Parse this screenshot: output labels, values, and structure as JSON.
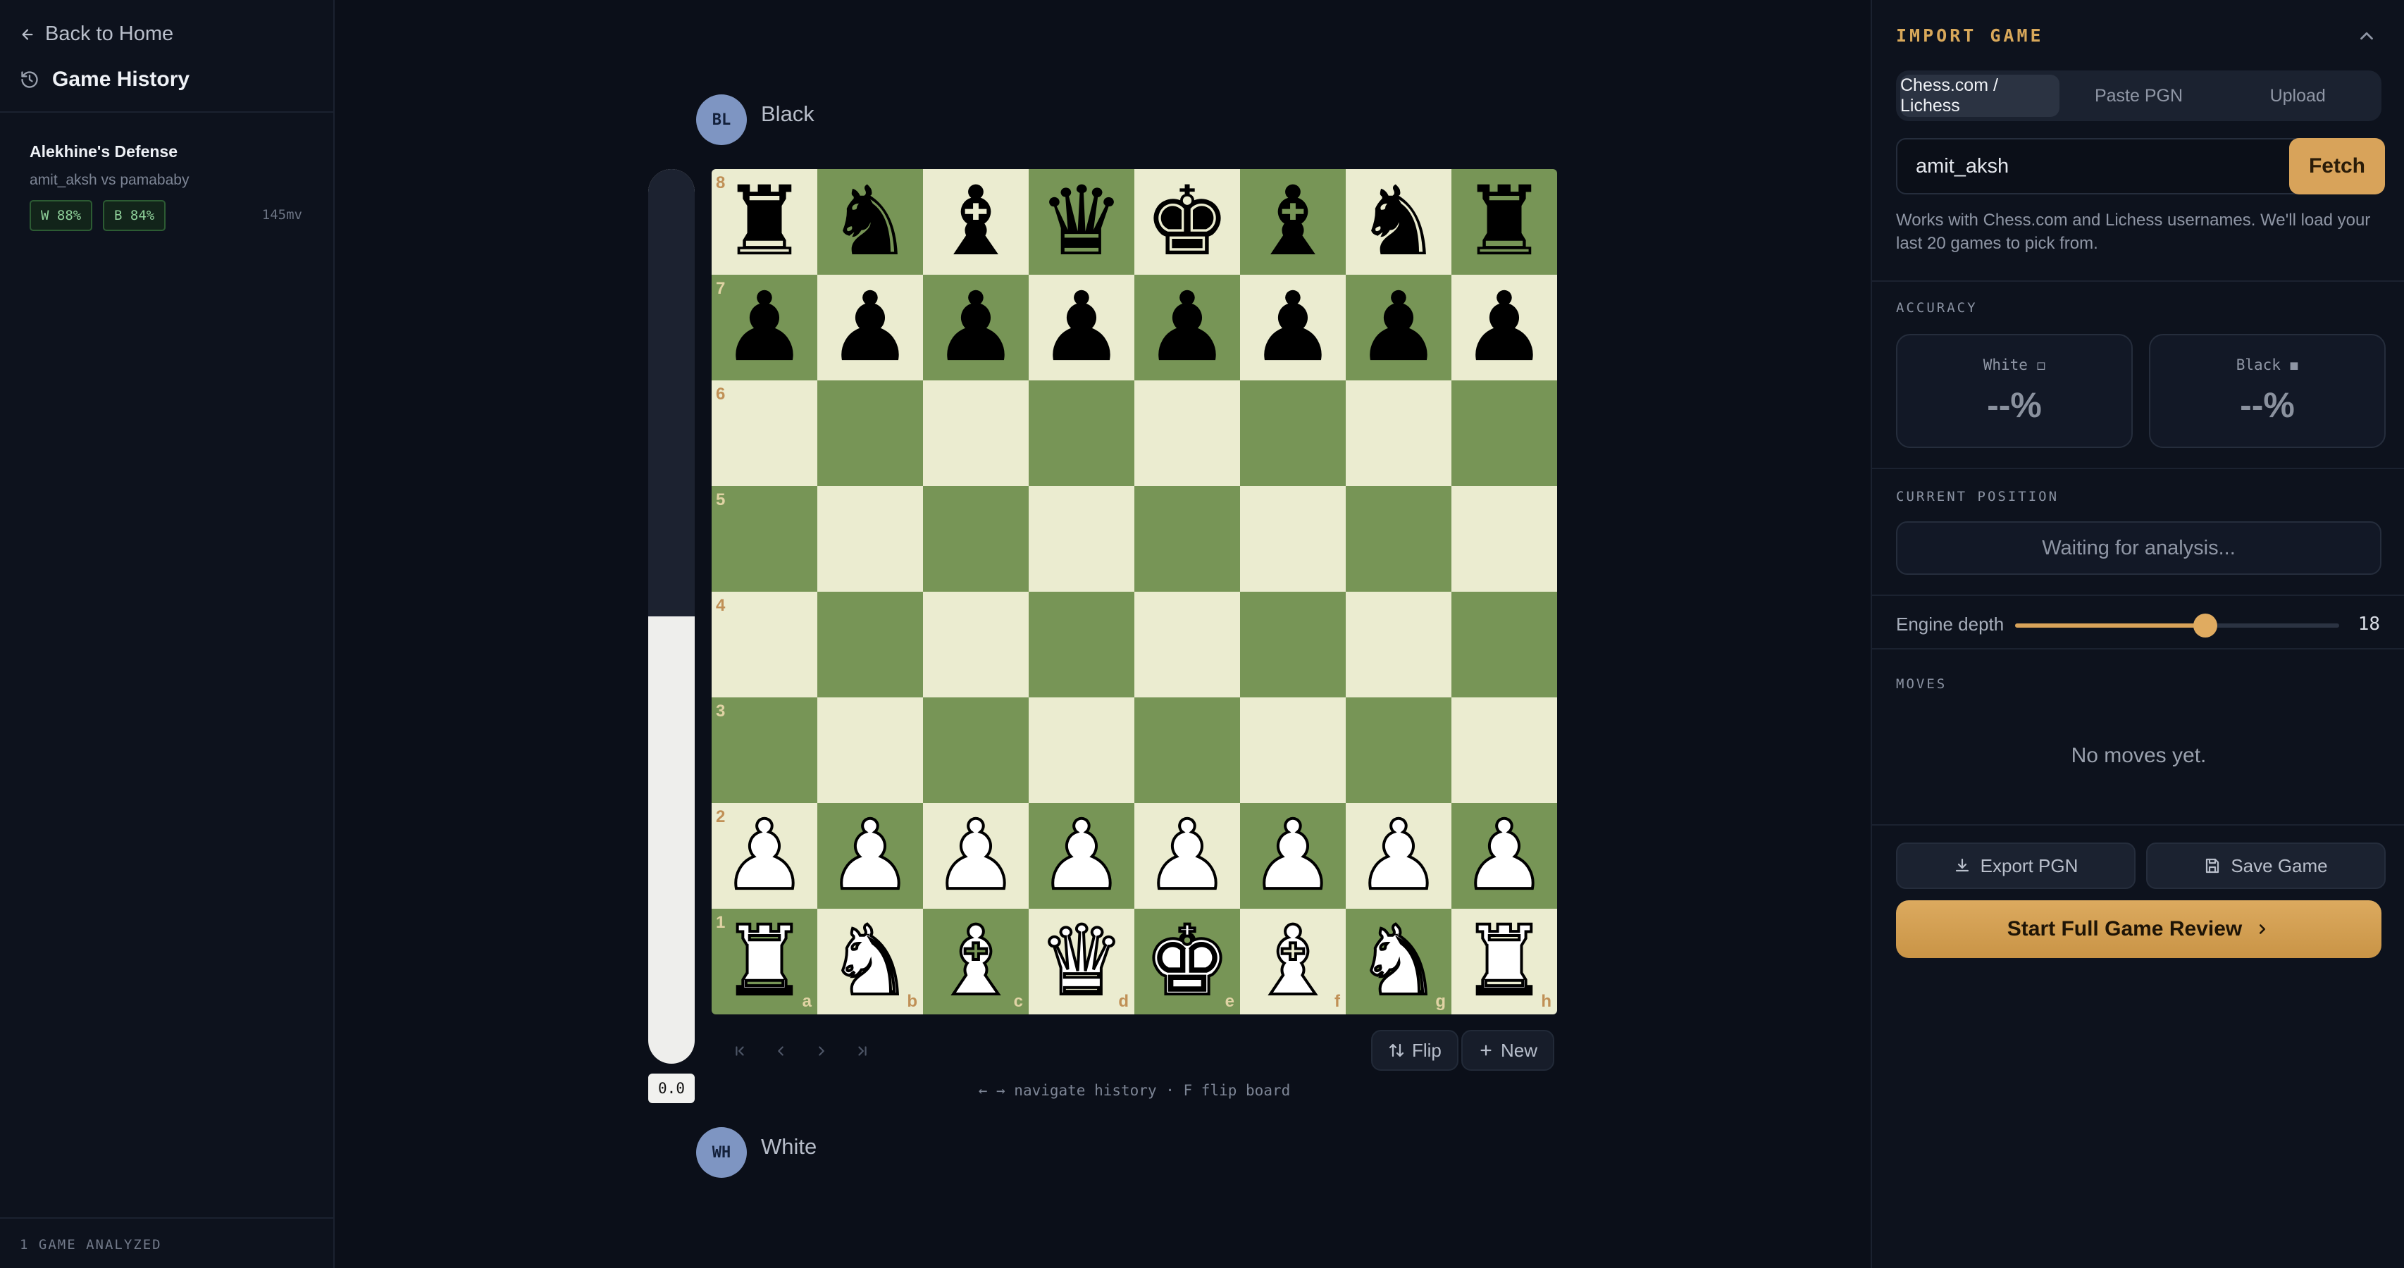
{
  "sidebar": {
    "back_label": "Back to Home",
    "title": "Game History",
    "games": [
      {
        "name": "Alekhine's Defense",
        "players": "amit_aksh vs pamababy",
        "white_acc": "W 88%",
        "black_acc": "B 84%",
        "moves": "145mv"
      }
    ],
    "footer": "1 GAME ANALYZED"
  },
  "board": {
    "top_player": {
      "initials": "BL",
      "name": "Black"
    },
    "bottom_player": {
      "initials": "WH",
      "name": "White"
    },
    "eval_text": "0.0",
    "eval_white_fraction": 0.5,
    "flip_label": "Flip",
    "new_label": "New",
    "hint": "← → navigate history · F flip board",
    "ranks": [
      "8",
      "7",
      "6",
      "5",
      "4",
      "3",
      "2",
      "1"
    ],
    "files": [
      "a",
      "b",
      "c",
      "d",
      "e",
      "f",
      "g",
      "h"
    ],
    "position": [
      [
        "r",
        "n",
        "b",
        "q",
        "k",
        "b",
        "n",
        "r"
      ],
      [
        "p",
        "p",
        "p",
        "p",
        "p",
        "p",
        "p",
        "p"
      ],
      [
        "",
        "",
        "",
        "",
        "",
        "",
        "",
        ""
      ],
      [
        "",
        "",
        "",
        "",
        "",
        "",
        "",
        ""
      ],
      [
        "",
        "",
        "",
        "",
        "",
        "",
        "",
        ""
      ],
      [
        "",
        "",
        "",
        "",
        "",
        "",
        "",
        ""
      ],
      [
        "P",
        "P",
        "P",
        "P",
        "P",
        "P",
        "P",
        "P"
      ],
      [
        "R",
        "N",
        "B",
        "Q",
        "K",
        "B",
        "N",
        "R"
      ]
    ]
  },
  "panel": {
    "import_title": "IMPORT GAME",
    "tabs": [
      "Chess.com / Lichess",
      "Paste PGN",
      "Upload"
    ],
    "active_tab": 0,
    "username_value": "amit_aksh",
    "fetch_label": "Fetch",
    "help": "Works with Chess.com and Lichess usernames. We'll load your last 20 games to pick from.",
    "accuracy_label": "ACCURACY",
    "white_label": "White ◻",
    "black_label": "Black ◼",
    "white_value": "--%",
    "black_value": "--%",
    "current_position_label": "CURRENT POSITION",
    "position_status": "Waiting for analysis...",
    "depth_label": "Engine depth",
    "depth_value": "18",
    "depth_min": 1,
    "depth_max": 30,
    "moves_label": "MOVES",
    "no_moves": "No moves yet.",
    "export_label": "Export PGN",
    "save_label": "Save Game",
    "review_label": "Start Full Game Review"
  },
  "colors": {
    "accent": "#d8a35a",
    "board_light": "#ebecd0",
    "board_dark": "#779556"
  }
}
